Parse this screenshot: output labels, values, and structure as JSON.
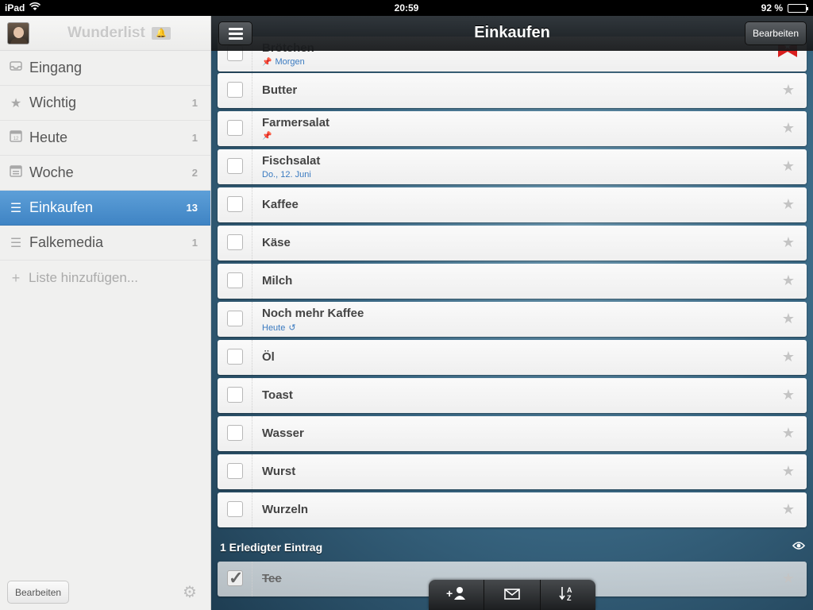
{
  "status": {
    "device": "iPad",
    "time": "20:59",
    "battery": "92 %"
  },
  "sidebar": {
    "brand": "Wunderlist",
    "items": [
      {
        "label": "Eingang",
        "count": "",
        "icon": "inbox-icon"
      },
      {
        "label": "Wichtig",
        "count": "1",
        "icon": "star-icon"
      },
      {
        "label": "Heute",
        "count": "1",
        "icon": "calendar-day-icon"
      },
      {
        "label": "Woche",
        "count": "2",
        "icon": "calendar-week-icon"
      },
      {
        "label": "Einkaufen",
        "count": "13",
        "icon": "list-icon"
      },
      {
        "label": "Falkemedia",
        "count": "1",
        "icon": "list-icon"
      }
    ],
    "add_label": "Liste hinzufügen...",
    "edit_label": "Bearbeiten"
  },
  "header": {
    "title": "Einkaufen",
    "edit_label": "Bearbeiten"
  },
  "tasks": [
    {
      "name": "Brötchen",
      "sub": "Morgen"
    },
    {
      "name": "Butter"
    },
    {
      "name": "Farmersalat"
    },
    {
      "name": "Fischsalat",
      "sub": "Do., 12. Juni"
    },
    {
      "name": "Kaffee"
    },
    {
      "name": "Käse"
    },
    {
      "name": "Milch"
    },
    {
      "name": "Noch mehr Kaffee",
      "sub": "Heute"
    },
    {
      "name": "Öl"
    },
    {
      "name": "Toast"
    },
    {
      "name": "Wasser"
    },
    {
      "name": "Wurst"
    },
    {
      "name": "Wurzeln"
    }
  ],
  "completed": {
    "header": "1 Erledigter Eintrag",
    "items": [
      {
        "name": "Tee"
      }
    ]
  },
  "colors": {
    "accent": "#4a90d2",
    "ribbon": "#d81e1e"
  }
}
